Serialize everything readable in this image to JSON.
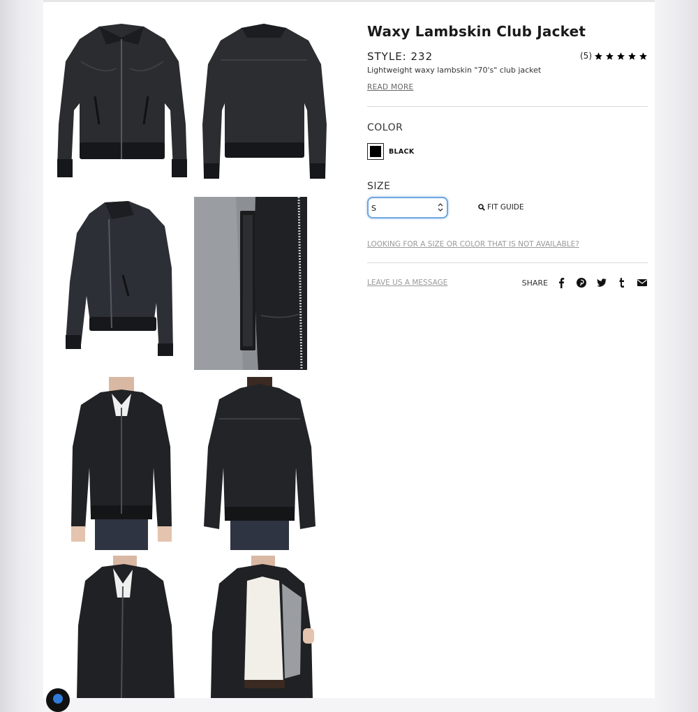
{
  "product": {
    "title": "Waxy Lambskin Club Jacket",
    "style": "STYLE: 232",
    "rating_count": "(5)",
    "rating_stars": 5,
    "subtitle": "Lightweight waxy lambskin \"70's\" club jacket",
    "read_more": "READ MORE"
  },
  "color": {
    "label": "COLOR",
    "selected": "BLACK",
    "swatch_hex": "#000000"
  },
  "size": {
    "label": "SIZE",
    "selected": "S",
    "fit_guide": "FIT GUIDE",
    "not_available": "LOOKING FOR A SIZE OR COLOR THAT IS NOT AVAILABLE?"
  },
  "footer": {
    "leave_message": "LEAVE US A MESSAGE",
    "share_label": "SHARE",
    "share_icons": [
      "facebook-icon",
      "pinterest-icon",
      "twitter-icon",
      "tumblr-icon",
      "email-icon"
    ]
  },
  "gallery": {
    "images": [
      "jacket-front",
      "jacket-back",
      "jacket-three-quarter",
      "lining-detail",
      "model-front",
      "model-back",
      "model-angle",
      "model-open"
    ]
  }
}
